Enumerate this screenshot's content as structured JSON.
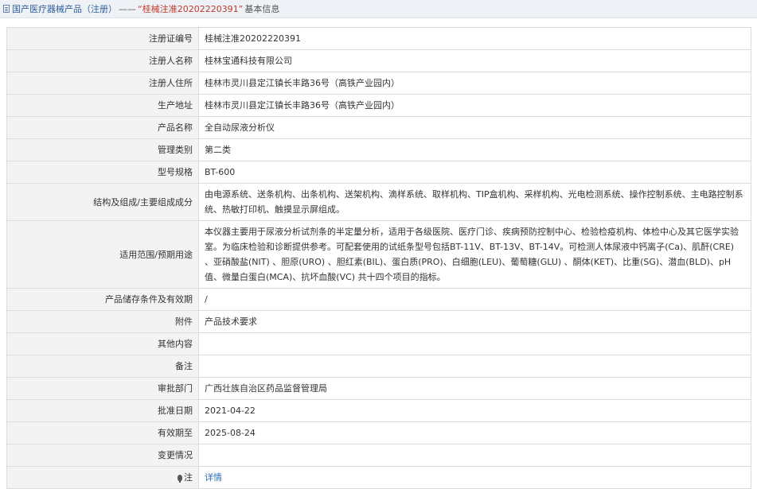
{
  "breadcrumb": {
    "root": "国产医疗器械产品（注册）",
    "separator": "——",
    "current": "“桂械注准20202220391”",
    "suffix": "基本信息"
  },
  "rows": [
    {
      "label": "注册证编号",
      "value": "桂械注准20202220391"
    },
    {
      "label": "注册人名称",
      "value": "桂林宝通科技有限公司"
    },
    {
      "label": "注册人住所",
      "value": "桂林市灵川县定江镇长丰路36号（高铁产业园内）"
    },
    {
      "label": "生产地址",
      "value": "桂林市灵川县定江镇长丰路36号（高铁产业园内）"
    },
    {
      "label": "产品名称",
      "value": "全自动尿液分析仪"
    },
    {
      "label": "管理类别",
      "value": "第二类"
    },
    {
      "label": "型号规格",
      "value": "BT-600"
    },
    {
      "label": "结构及组成/主要组成成分",
      "value": "由电源系统、送条机构、出条机构、送架机构、滴样系统、取样机构、TIP盒机构、采样机构、光电检测系统、操作控制系统、主电路控制系统、热敏打印机、触摸显示屏组成。"
    },
    {
      "label": "适用范围/预期用途",
      "value": "本仪器主要用于尿液分析试剂条的半定量分析，适用于各级医院、医疗门诊、疾病预防控制中心、检验检疫机构、体检中心及其它医学实验室。为临床检验和诊断提供参考。可配套使用的试纸条型号包括BT-11V、BT-13V、BT-14V。可检测人体尿液中钙离子(Ca)、肌酐(CRE) 、亚硝酸盐(NIT) 、胆原(URO) 、胆红素(BIL)、蛋白质(PRO)、白细胞(LEU)、葡萄糖(GLU) 、酮体(KET)、比重(SG)、潜血(BLD)、pH值、微量白蛋白(MCA)、抗坏血酸(VC) 共十四个项目的指标。"
    },
    {
      "label": "产品储存条件及有效期",
      "value": "/"
    },
    {
      "label": "附件",
      "value": "产品技术要求"
    },
    {
      "label": "其他内容",
      "value": ""
    },
    {
      "label": "备注",
      "value": ""
    },
    {
      "label": "审批部门",
      "value": "广西壮族自治区药品监督管理局"
    },
    {
      "label": "批准日期",
      "value": "2021-04-22"
    },
    {
      "label": "有效期至",
      "value": "2025-08-24"
    },
    {
      "label": "变更情况",
      "value": ""
    }
  ],
  "note": {
    "label": "注",
    "link": "详情",
    "icon": "pin-icon"
  }
}
